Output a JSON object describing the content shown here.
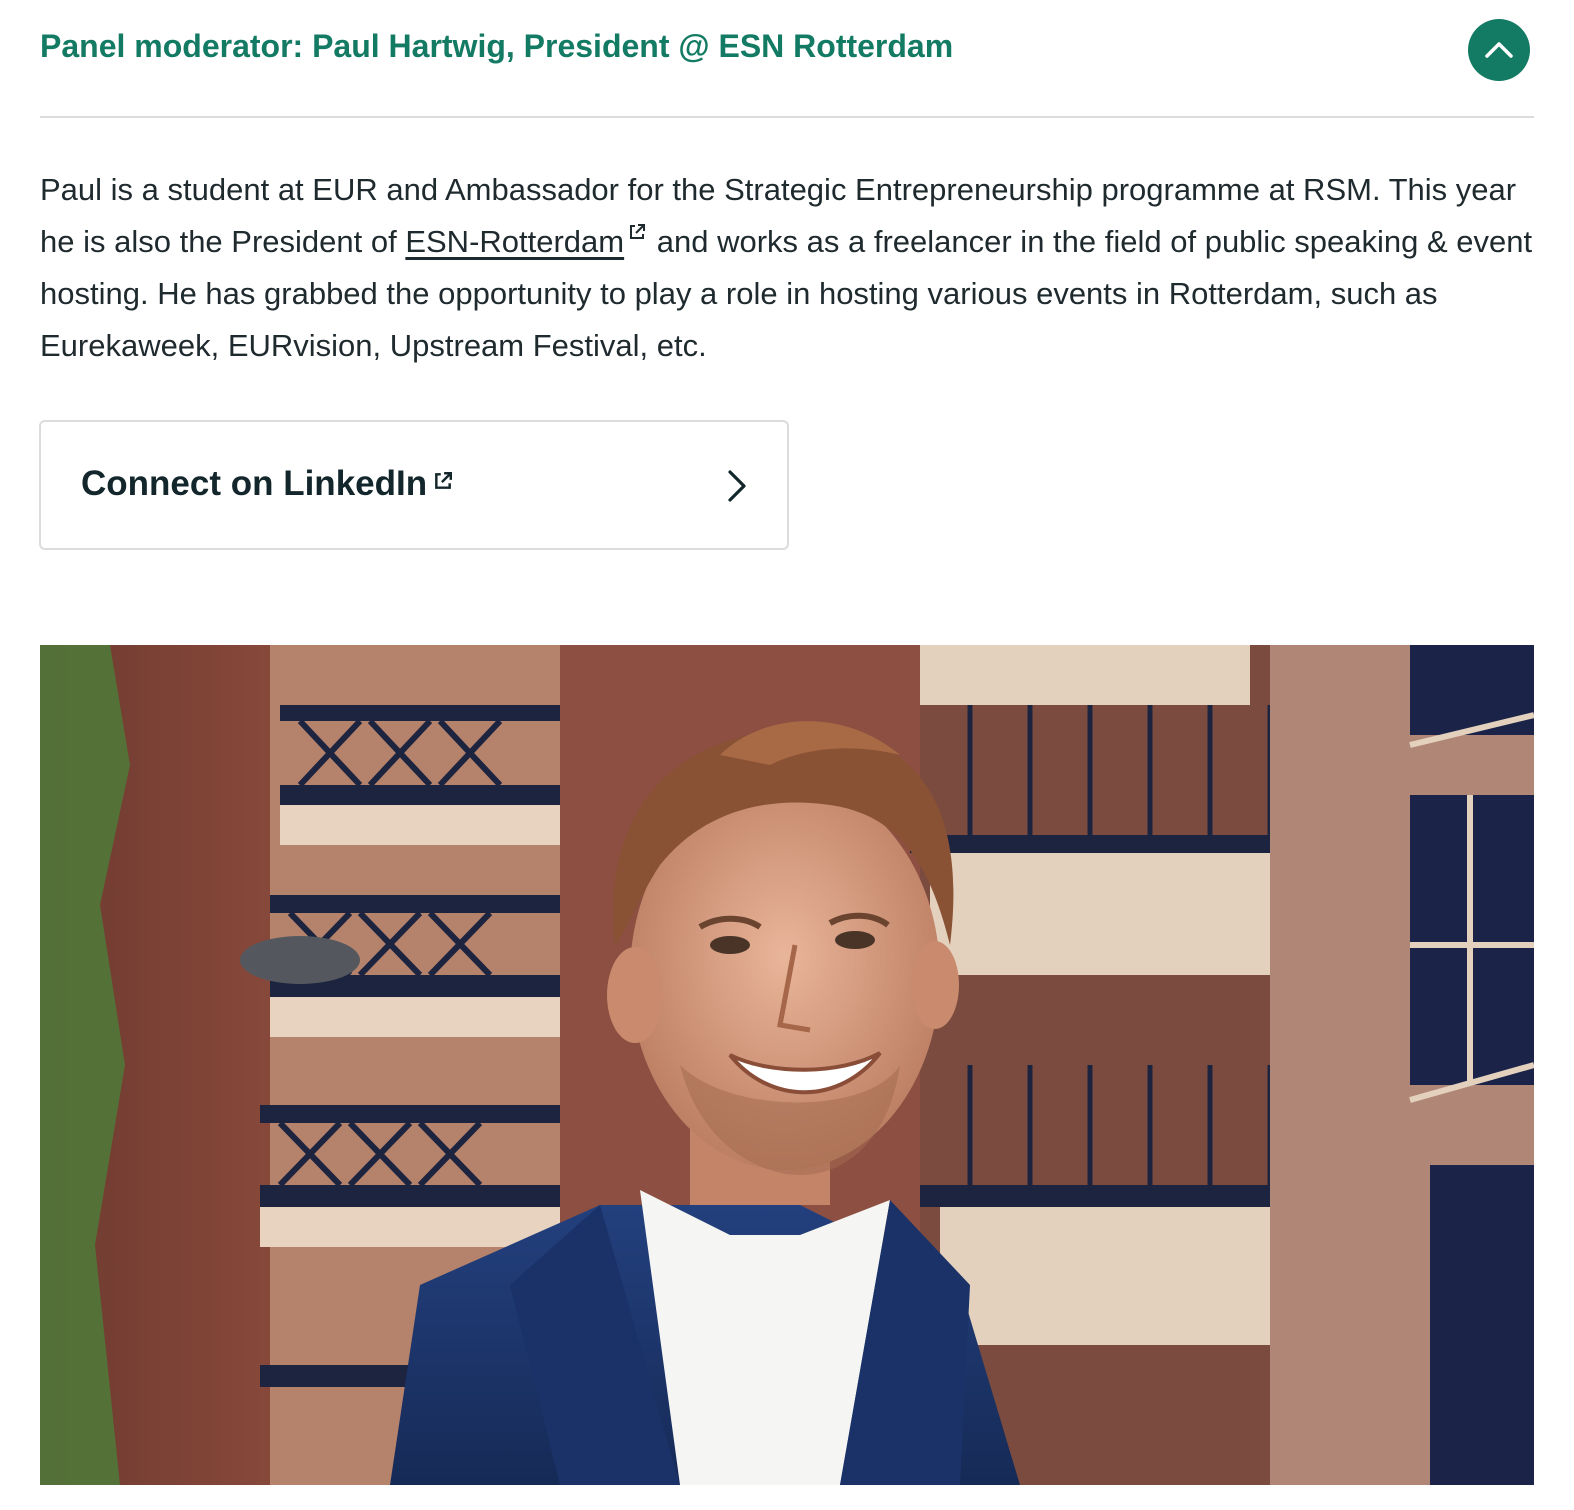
{
  "accordion": {
    "title": "Panel moderator: Paul Hartwig, President @ ESN Rotterdam",
    "toggle_icon": "chevron-up-icon"
  },
  "bio": {
    "text_part1": "Paul is a student at EUR and Ambassador for the Strategic Entrepreneurship programme at RSM. This year he is also the President of ",
    "link_text": "ESN-Rotterdam",
    "text_part2": " and works as a freelancer in the field of public speaking & event hosting. He has grabbed the opportunity to play a role in hosting various events in Rotterdam, such as Eurekaweek, EURvision, Upstream Festival, etc."
  },
  "linkedin_card": {
    "label": "Connect on LinkedIn",
    "external_icon": "external-link-icon",
    "arrow_icon": "chevron-right-icon"
  },
  "colors": {
    "accent": "#137a63",
    "text": "#1f2a2e",
    "divider": "#dcdcdc"
  }
}
